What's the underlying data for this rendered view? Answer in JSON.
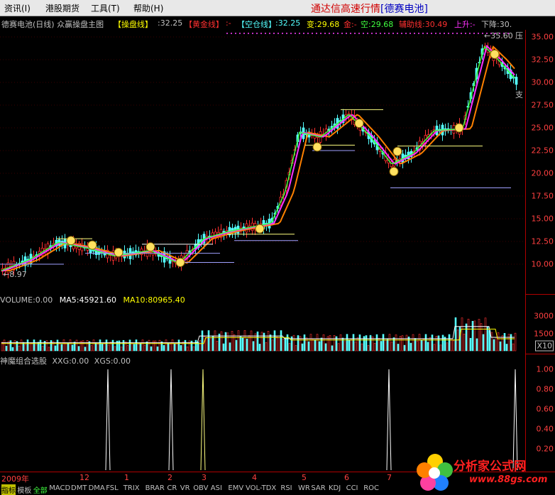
{
  "menu": {
    "items": [
      "资讯(I)",
      "港股期货",
      "工具(T)",
      "帮助(H)"
    ]
  },
  "app_title": "通达信高速行情",
  "stock_tag": "[德赛电池]",
  "main_header": {
    "name": "德赛电池(日线) 众赢操盘主图",
    "caopan_label": "【操盘线】",
    "caopan_value": ":32.25",
    "huangjin_label": "【黄金线】",
    "huangjin_value": ":-",
    "kongcang_label": "【空仓线】",
    "kongcang_value": ":32.25",
    "bian_text": "变:29.68",
    "jin_text": "金:-",
    "kong_text": "空:29.68",
    "fuzhu_text": "辅助线:30.49",
    "shangsheng_text": "上升:-",
    "xiajiang_text": "下降:30."
  },
  "price_axis": {
    "ticks": [
      "35.00",
      "32.50",
      "30.00",
      "27.50",
      "25.00",
      "22.50",
      "20.00",
      "17.50",
      "15.00",
      "12.50",
      "10.00"
    ]
  },
  "annotations": {
    "high": "35.60",
    "pressure": "压",
    "support": "支",
    "low": "8.97"
  },
  "volume": {
    "header_volume": "VOLUME:0.00",
    "header_ma5": "MA5:45921.60",
    "header_ma10": "MA10:80965.40",
    "ticks": [
      "3000",
      "1500"
    ],
    "unit": "X10"
  },
  "xg": {
    "header_name": "神魔组合选股",
    "header_xxg": "XXG:0.00",
    "header_xgs": "XGS:0.00",
    "ticks": [
      "1.00",
      "0.80",
      "0.60",
      "0.40",
      "0.20"
    ]
  },
  "dates": [
    "2009年",
    "12",
    "1",
    "2",
    "3",
    "4",
    "5",
    "6",
    "7"
  ],
  "tabs": [
    "指标",
    "模板",
    "全部",
    "MACD",
    "DMT",
    "DMA",
    "FSL",
    "TRIX",
    "BRAR",
    "CR",
    "VR",
    "OBV",
    "ASI",
    "EMV",
    "VOL-TDX",
    "RSI",
    "WR",
    "SAR",
    "KDJ",
    "CCI",
    "ROC"
  ],
  "watermark": {
    "text": "分析家公式网",
    "url": "www.88gs.com"
  },
  "colors": {
    "bg": "#000000",
    "axis": "#b00000",
    "up": "#ff3030",
    "down": "#54ffff",
    "ma_orange": "#ff8000",
    "ma_magenta": "#ff30ff",
    "ma_green": "#40ff40",
    "yellow": "#ffff00"
  }
}
